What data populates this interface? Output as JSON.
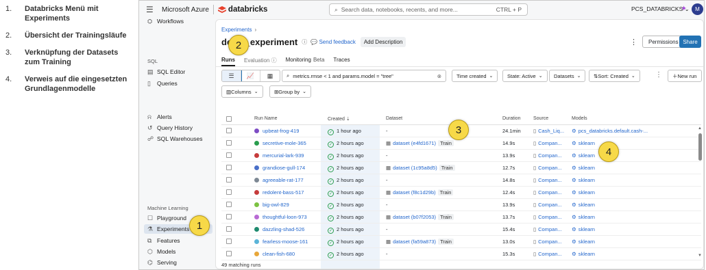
{
  "legend": [
    {
      "num": "1.",
      "text": "Databricks Menü mit Experiments"
    },
    {
      "num": "2.",
      "text": "Übersicht der Trainingsläufe"
    },
    {
      "num": "3.",
      "text": "Verknüpfung der Datasets zum Training"
    },
    {
      "num": "4.",
      "text": "Verweis auf die eingesetzten Grundlagenmodelle"
    }
  ],
  "topbar": {
    "azure": "Microsoft Azure",
    "brand": "databricks",
    "search_placeholder": "Search data, notebooks, recents, and more...",
    "shortcut": "CTRL + P",
    "workspace": "PCS_DATABRICKS",
    "avatar": "M"
  },
  "sidebar": {
    "workflows": "Workflows",
    "sql_head": "SQL",
    "sql_editor": "SQL Editor",
    "queries": "Queries",
    "alerts": "Alerts",
    "query_history": "Query History",
    "sql_warehouses": "SQL Warehouses",
    "ml_head": "Machine Learning",
    "playground": "Playground",
    "experiments": "Experiments",
    "features": "Features",
    "models": "Models",
    "serving": "Serving"
  },
  "main": {
    "breadcrumb": "Experiments",
    "title": "demo_experiment",
    "send_feedback": "Send feedback",
    "add_description": "Add Description",
    "permissions": "Permissions",
    "share": "Share",
    "tabs": {
      "runs": "Runs",
      "evaluation": "Evaluation",
      "monitoring": "Monitoring",
      "beta": "Beta",
      "traces": "Traces"
    },
    "filter_query": "metrics.rmse < 1 and params.model = \"tree\"",
    "time_created": "Time created",
    "state": "State: Active",
    "datasets": "Datasets",
    "sort": "Sort: Created",
    "new_run": "New run",
    "columns": "Columns",
    "group_by": "Group by",
    "footer": "49 matching runs"
  },
  "table": {
    "headers": {
      "run_name": "Run Name",
      "created": "Created",
      "dataset": "Dataset",
      "duration": "Duration",
      "source": "Source",
      "models": "Models"
    },
    "rows": [
      {
        "name": "upbeat-frog-419",
        "color": "#7d4cc4",
        "created": "1 hour ago",
        "dataset": "-",
        "train": "",
        "duration": "24.1min",
        "source": "Cash_Liq...",
        "model": "pcs_databricks.default.cash-..."
      },
      {
        "name": "secretive-mole-365",
        "color": "#2a9d4e",
        "created": "2 hours ago",
        "dataset": "dataset (e4fd1671)",
        "train": "Train",
        "duration": "14.9s",
        "source": "Compan...",
        "model": "sklearn"
      },
      {
        "name": "mercurial-lark-939",
        "color": "#c63c3c",
        "created": "2 hours ago",
        "dataset": "-",
        "train": "",
        "duration": "13.9s",
        "source": "Compan...",
        "model": "sklearn"
      },
      {
        "name": "grandiose-gull-174",
        "color": "#4a6fc8",
        "created": "2 hours ago",
        "dataset": "dataset (1c95a8d5)",
        "train": "Train",
        "duration": "12.7s",
        "source": "Compan...",
        "model": "sklearn"
      },
      {
        "name": "agreeable-rat-177",
        "color": "#7d8894",
        "created": "2 hours ago",
        "dataset": "-",
        "train": "",
        "duration": "14.8s",
        "source": "Compan...",
        "model": "sklearn"
      },
      {
        "name": "redolent-bass-517",
        "color": "#c63c3c",
        "created": "2 hours ago",
        "dataset": "dataset (f8c1d29b)",
        "train": "Train",
        "duration": "12.4s",
        "source": "Compan...",
        "model": "sklearn"
      },
      {
        "name": "big-owl-829",
        "color": "#7cc242",
        "created": "2 hours ago",
        "dataset": "-",
        "train": "",
        "duration": "13.9s",
        "source": "Compan...",
        "model": "sklearn"
      },
      {
        "name": "thoughtful-loon-973",
        "color": "#b86ad4",
        "created": "2 hours ago",
        "dataset": "dataset (b07f2053)",
        "train": "Train",
        "duration": "13.7s",
        "source": "Compan...",
        "model": "sklearn"
      },
      {
        "name": "dazzling-shad-526",
        "color": "#1e8a6e",
        "created": "2 hours ago",
        "dataset": "-",
        "train": "",
        "duration": "15.4s",
        "source": "Compan...",
        "model": "sklearn"
      },
      {
        "name": "fearless-moose-161",
        "color": "#5ab4d8",
        "created": "2 hours ago",
        "dataset": "dataset (fa59a873)",
        "train": "Train",
        "duration": "13.0s",
        "source": "Compan...",
        "model": "sklearn"
      },
      {
        "name": "clean-fish-680",
        "color": "#e8a73a",
        "created": "2 hours ago",
        "dataset": "-",
        "train": "",
        "duration": "15.3s",
        "source": "Compan...",
        "model": "sklearn"
      }
    ]
  },
  "callouts": [
    "1",
    "2",
    "3",
    "4"
  ],
  "colors": {
    "accent": "#2272b4",
    "callout": "#f7d948",
    "active_sidebar": "#dde5ef"
  }
}
